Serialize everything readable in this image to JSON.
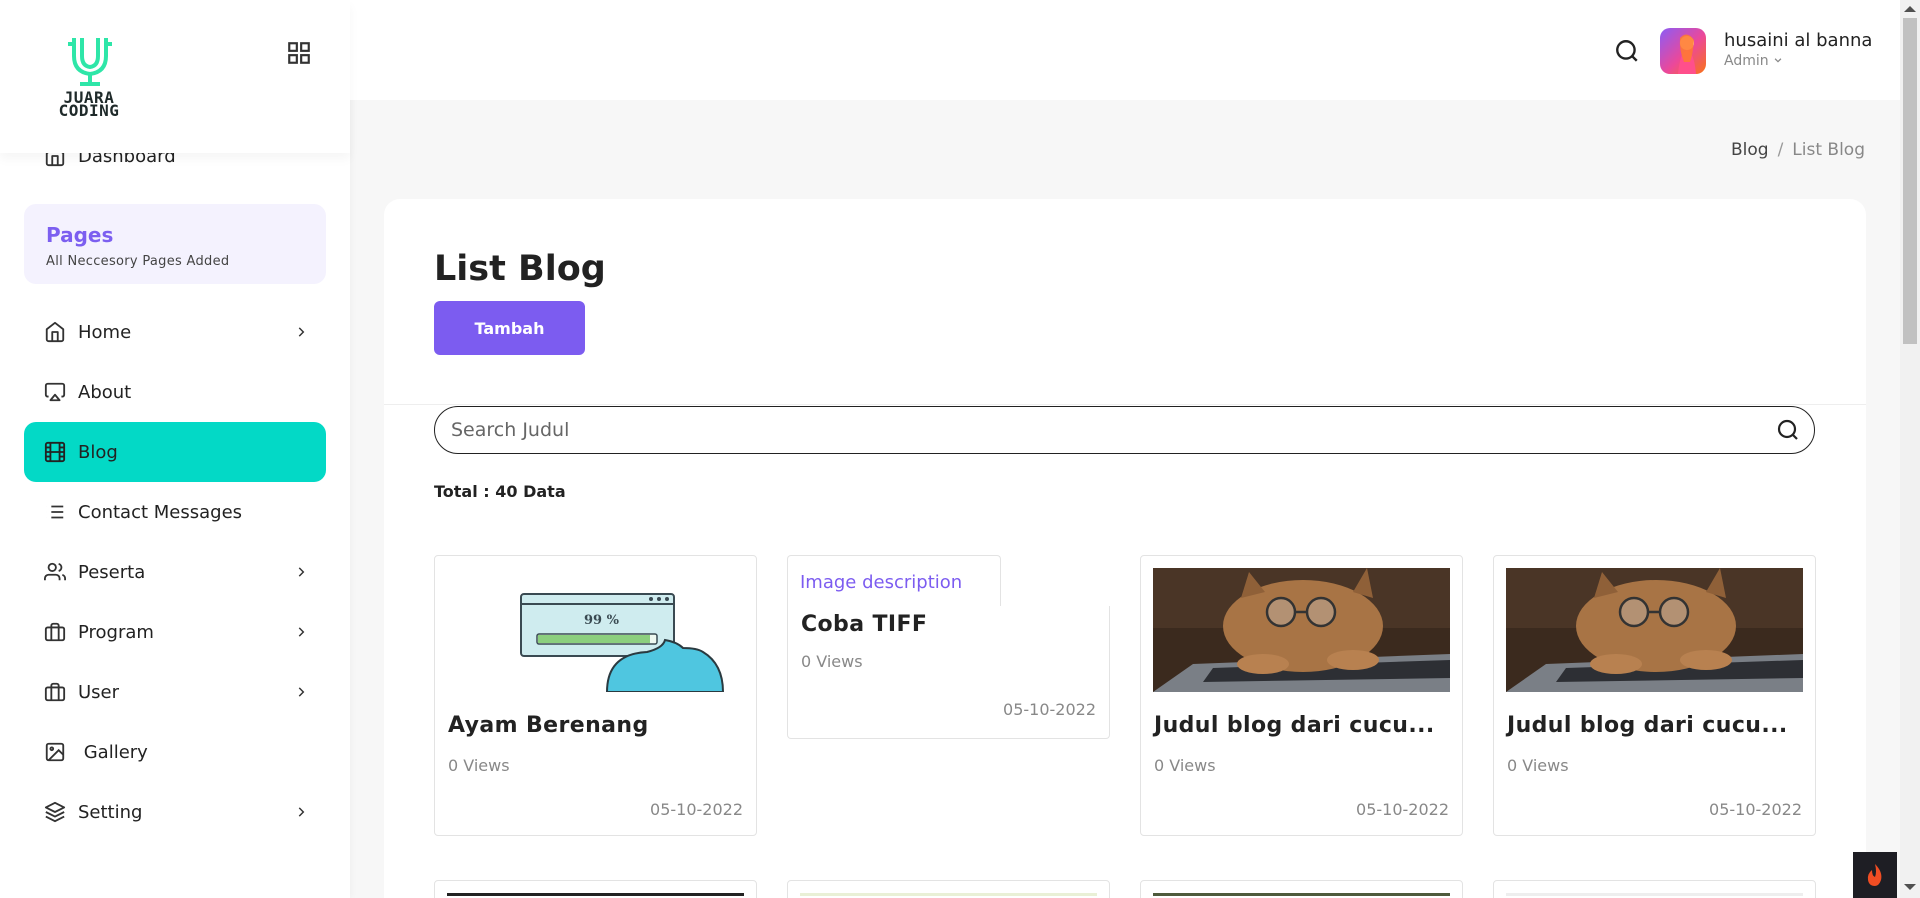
{
  "app": {
    "logo_line1": "JUARA",
    "logo_line2": "CODING",
    "brand_color": "#2ee6a8"
  },
  "sidebar": {
    "dashboard_label": "Dashboard",
    "pages_title": "Pages",
    "pages_subtitle": "All Neccesory Pages Added",
    "items": [
      {
        "label": "Home",
        "icon": "home-icon",
        "has_submenu": true
      },
      {
        "label": "About",
        "icon": "airplay-icon",
        "has_submenu": false
      },
      {
        "label": "Blog",
        "icon": "film-icon",
        "has_submenu": false,
        "active": true
      },
      {
        "label": "Contact Messages",
        "icon": "list-icon",
        "has_submenu": false
      },
      {
        "label": "Peserta",
        "icon": "users-icon",
        "has_submenu": true
      },
      {
        "label": "Program",
        "icon": "briefcase-icon",
        "has_submenu": true
      },
      {
        "label": "User",
        "icon": "briefcase-icon",
        "has_submenu": true
      },
      {
        "label": " Gallery",
        "icon": "image-icon",
        "has_submenu": false
      },
      {
        "label": "Setting",
        "icon": "layers-icon",
        "has_submenu": true
      }
    ],
    "active_color": "#03d9c6",
    "accent_color": "#7c5cf0"
  },
  "header": {
    "user_name": "husaini al banna",
    "user_role": "Admin"
  },
  "breadcrumb": {
    "parent": "Blog",
    "separator": "/",
    "current": "List Blog"
  },
  "main": {
    "title": "List Blog",
    "add_button": "Tambah",
    "search_placeholder": "Search Judul",
    "total_text": "Total : 40 Data",
    "cards": [
      {
        "title": "Ayam Berenang",
        "views": "0 Views",
        "date": "05-10-2022",
        "image": "loading-illustration",
        "image_text": "99 %"
      },
      {
        "title": "Coba TIFF",
        "views": "0 Views",
        "date": "05-10-2022",
        "image_alt": "Image description"
      },
      {
        "title": "Judul blog dari cucu...",
        "views": "0 Views",
        "date": "05-10-2022",
        "image": "cat-with-glasses-photo"
      },
      {
        "title": "Judul blog dari cucu...",
        "views": "0 Views",
        "date": "05-10-2022",
        "image": "cat-with-glasses-photo"
      }
    ]
  }
}
